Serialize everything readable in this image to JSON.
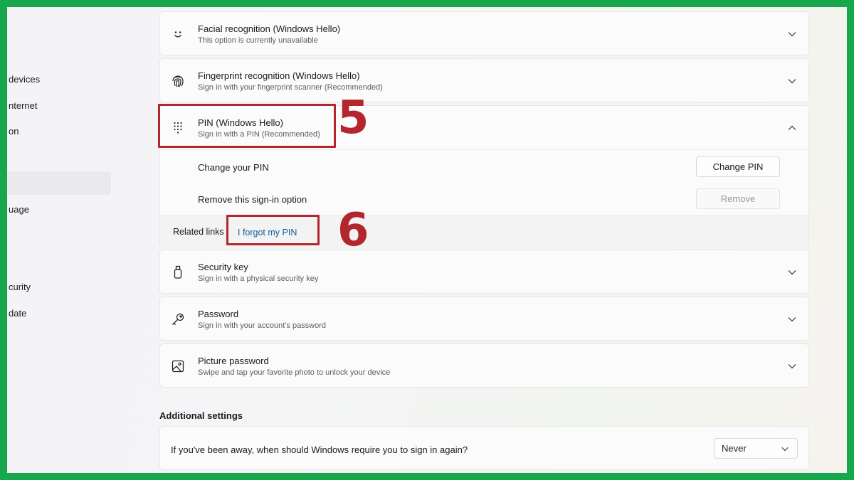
{
  "sidebar": {
    "items": [
      {
        "label": "devices"
      },
      {
        "label": "nternet"
      },
      {
        "label": "on"
      },
      {
        "label": ""
      },
      {
        "label": "uage"
      },
      {
        "label": "curity"
      },
      {
        "label": "date"
      }
    ]
  },
  "signin_options": {
    "facial": {
      "title": "Facial recognition (Windows Hello)",
      "subtitle": "This option is currently unavailable",
      "icon": "smiley-icon"
    },
    "fingerprint": {
      "title": "Fingerprint recognition (Windows Hello)",
      "subtitle": "Sign in with your fingerprint scanner (Recommended)",
      "icon": "fingerprint-icon"
    },
    "pin": {
      "title": "PIN (Windows Hello)",
      "subtitle": "Sign in with a PIN (Recommended)",
      "icon": "keypad-icon",
      "change_label": "Change your PIN",
      "change_button": "Change PIN",
      "remove_label": "Remove this sign-in option",
      "remove_button": "Remove",
      "related_label": "Related links",
      "forgot_link": "I forgot my PIN"
    },
    "security_key": {
      "title": "Security key",
      "subtitle": "Sign in with a physical security key",
      "icon": "usb-key-icon"
    },
    "password": {
      "title": "Password",
      "subtitle": "Sign in with your account's password",
      "icon": "key-icon"
    },
    "picture": {
      "title": "Picture password",
      "subtitle": "Swipe and tap your favorite photo to unlock your device",
      "icon": "picture-icon"
    }
  },
  "additional": {
    "heading": "Additional settings",
    "away_question": "If you've been away, when should Windows require you to sign in again?",
    "away_value": "Never"
  },
  "annotations": {
    "step5": "5",
    "step6": "6",
    "color": "#b3262e"
  },
  "colors": {
    "frame": "#16a84a",
    "link": "#0d5e9c"
  }
}
